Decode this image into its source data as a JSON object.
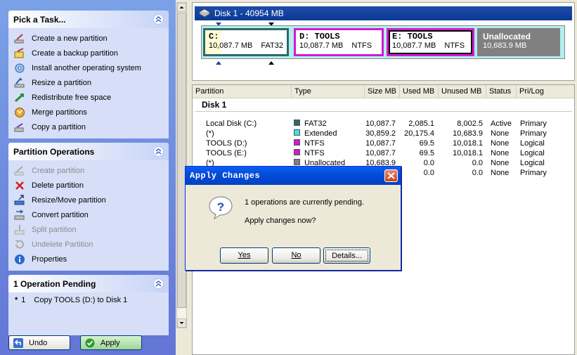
{
  "tasks_panel": {
    "title": "Pick a Task...",
    "items": [
      {
        "label": "Create a new partition",
        "icon": "create-partition-icon"
      },
      {
        "label": "Create a backup partition",
        "icon": "backup-partition-icon"
      },
      {
        "label": "Install another operating system",
        "icon": "install-os-icon"
      },
      {
        "label": "Resize a partition",
        "icon": "resize-partition-icon"
      },
      {
        "label": "Redistribute free space",
        "icon": "redistribute-icon"
      },
      {
        "label": "Merge partitions",
        "icon": "merge-icon"
      },
      {
        "label": "Copy a partition",
        "icon": "copy-partition-icon"
      }
    ]
  },
  "ops_panel": {
    "title": "Partition Operations",
    "items": [
      {
        "label": "Create partition",
        "enabled": false
      },
      {
        "label": "Delete partition",
        "enabled": true
      },
      {
        "label": "Resize/Move partition",
        "enabled": true
      },
      {
        "label": "Convert partition",
        "enabled": true
      },
      {
        "label": "Split partition",
        "enabled": false
      },
      {
        "label": "Undelete Partition",
        "enabled": false
      },
      {
        "label": "Properties",
        "enabled": true
      }
    ]
  },
  "pending_panel": {
    "title": "1 Operation Pending",
    "star": "*",
    "num": "1",
    "text": "Copy TOOLS (D:) to Disk 1"
  },
  "buttons": {
    "undo": "Undo",
    "apply": "Apply"
  },
  "disk": {
    "title": "Disk 1 - 40954 MB",
    "partitions": {
      "c": {
        "name": "C:",
        "size": "10,087.7 MB",
        "fs": "FAT32"
      },
      "d": {
        "name": "D:  TOOLS",
        "size": "10,087.7 MB",
        "fs": "NTFS"
      },
      "e": {
        "name": "E:  TOOLS",
        "size": "10,087.7 MB",
        "fs": "NTFS"
      },
      "u": {
        "name": "Unallocated",
        "size": "10,683.9 MB"
      }
    }
  },
  "table": {
    "headers": [
      "Partition",
      "Type",
      "Size MB",
      "Used MB",
      "Unused MB",
      "Status",
      "Pri/Log"
    ],
    "group": "Disk 1",
    "rows": [
      {
        "partition": "Local Disk (C:)",
        "type": "FAT32",
        "color": "#2c6a6a",
        "size": "10,087.7",
        "used": "2,085.1",
        "unused": "8,002.5",
        "status": "Active",
        "prilog": "Primary"
      },
      {
        "partition": "(*)",
        "type": "Extended",
        "color": "#40e0e0",
        "size": "30,859.2",
        "used": "20,175.4",
        "unused": "10,683.9",
        "status": "None",
        "prilog": "Primary"
      },
      {
        "partition": "TOOLS (D:)",
        "type": "NTFS",
        "color": "#d21ad2",
        "size": "10,087.7",
        "used": "69.5",
        "unused": "10,018.1",
        "status": "None",
        "prilog": "Logical"
      },
      {
        "partition": "TOOLS (E:)",
        "type": "NTFS",
        "color": "#d21ad2",
        "size": "10,087.7",
        "used": "69.5",
        "unused": "10,018.1",
        "status": "None",
        "prilog": "Logical"
      },
      {
        "partition": "(*)",
        "type": "Unallocated",
        "color": "#808080",
        "size": "10,683.9",
        "used": "0.0",
        "unused": "0.0",
        "status": "None",
        "prilog": "Logical"
      },
      {
        "partition": "",
        "type": "",
        "color": "",
        "size": "",
        "used": "0.0",
        "unused": "0.0",
        "status": "None",
        "prilog": "Primary"
      }
    ]
  },
  "dialog": {
    "title": "Apply Changes",
    "message1": "1 operations are currently pending.",
    "message2": "Apply changes now?",
    "yes": "Yes",
    "no": "No",
    "details": "Details..."
  }
}
